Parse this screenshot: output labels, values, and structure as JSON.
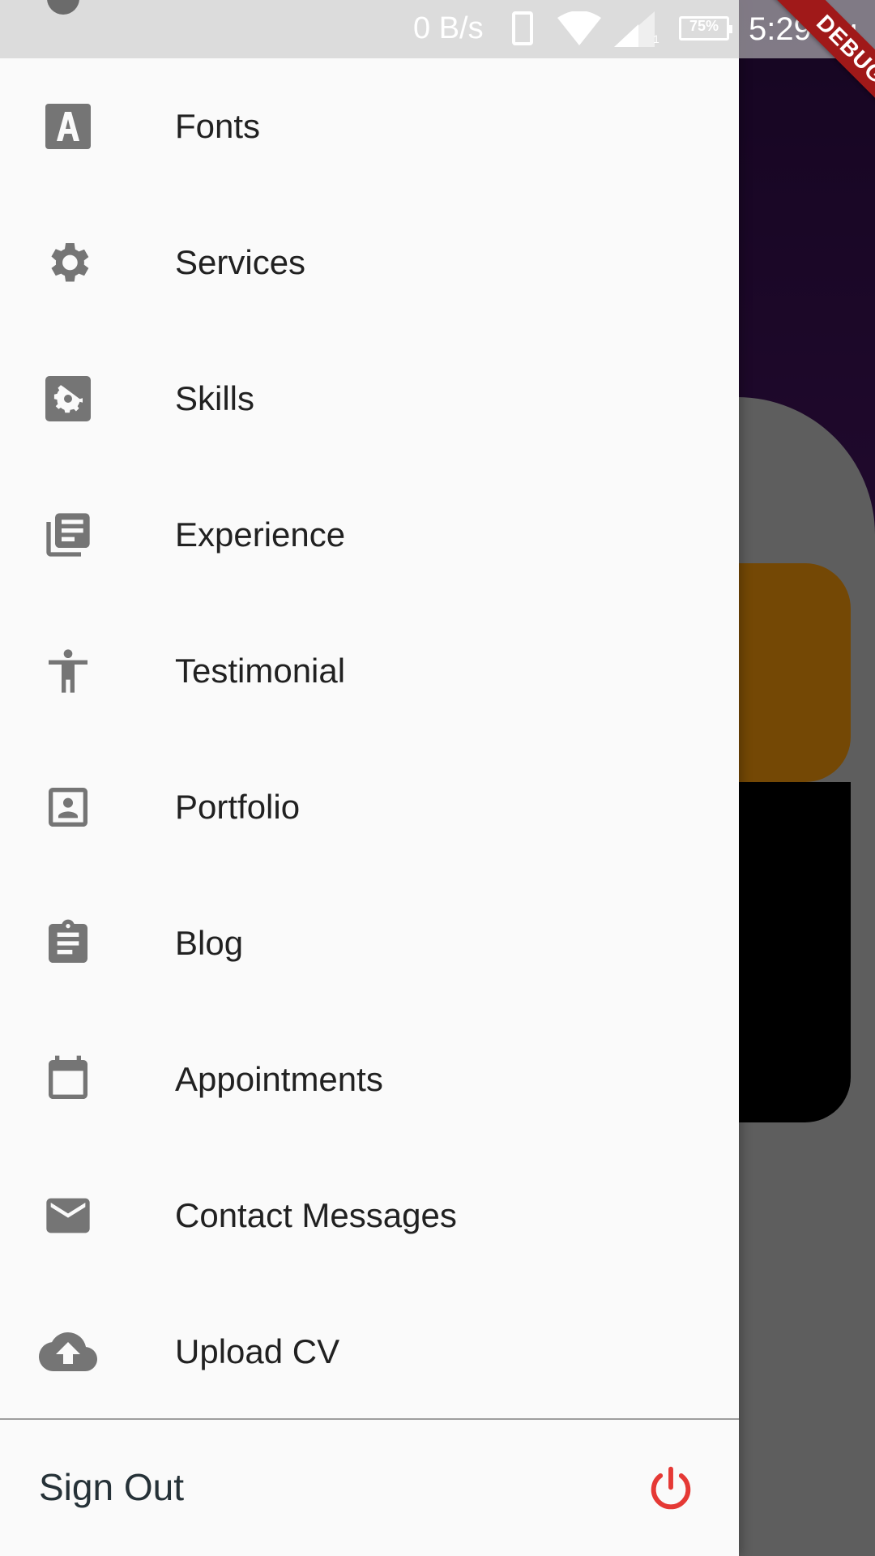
{
  "status_bar": {
    "net_speed": "0 B/s",
    "signal_sub": "1",
    "battery_percent": "75%",
    "time": "5:29",
    "ampm": "PM"
  },
  "debug_banner": "DEBUG",
  "drawer": {
    "items": [
      {
        "label": "Fonts",
        "icon": "font-icon"
      },
      {
        "label": "Services",
        "icon": "gear-icon"
      },
      {
        "label": "Skills",
        "icon": "settings-box-icon"
      },
      {
        "label": "Experience",
        "icon": "library-books-icon"
      },
      {
        "label": "Testimonial",
        "icon": "accessibility-icon"
      },
      {
        "label": "Portfolio",
        "icon": "portrait-icon"
      },
      {
        "label": "Blog",
        "icon": "clipboard-icon"
      },
      {
        "label": "Appointments",
        "icon": "calendar-icon"
      },
      {
        "label": "Contact Messages",
        "icon": "mail-icon"
      },
      {
        "label": "Upload CV",
        "icon": "cloud-upload-icon"
      }
    ],
    "sign_out_label": "Sign Out",
    "sign_out_icon": "power-icon"
  },
  "colors": {
    "icon_gray": "#757575",
    "text_dark": "#212121",
    "drawer_bg": "#fafafa",
    "power_red": "#e53935",
    "debug_red": "#a01919",
    "accent_orange": "#e8900a",
    "bg_purple": "#3e1257"
  }
}
